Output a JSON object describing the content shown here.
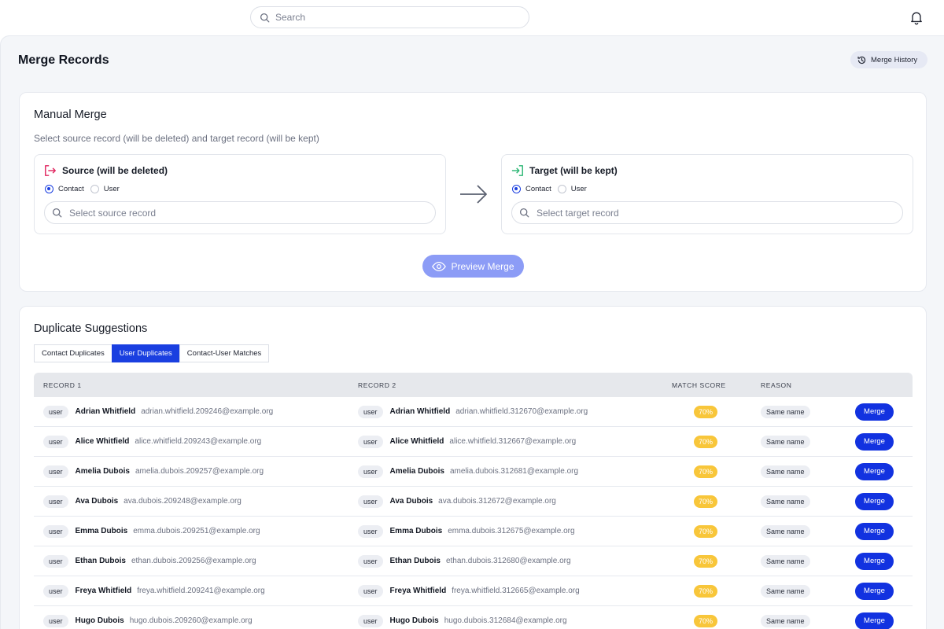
{
  "topbar": {
    "search_placeholder": "Search"
  },
  "page": {
    "title": "Merge Records",
    "history_label": "Merge History"
  },
  "manual": {
    "title": "Manual Merge",
    "subtitle": "Select source record (will be deleted) and target record (will be kept)",
    "source": {
      "title": "Source (will be deleted)",
      "options": [
        "Contact",
        "User"
      ],
      "selected": "Contact",
      "placeholder": "Select source record"
    },
    "target": {
      "title": "Target (will be kept)",
      "options": [
        "Contact",
        "User"
      ],
      "selected": "Contact",
      "placeholder": "Select target record"
    },
    "preview_label": "Preview Merge"
  },
  "duplicates": {
    "title": "Duplicate Suggestions",
    "tabs": [
      "Contact Duplicates",
      "User Duplicates",
      "Contact-User Matches"
    ],
    "active_tab": "User Duplicates",
    "columns": [
      "RECORD 1",
      "RECORD 2",
      "MATCH SCORE",
      "REASON"
    ],
    "merge_label": "Merge",
    "rows": [
      {
        "r1": {
          "type": "user",
          "name": "Adrian Whitfield",
          "email": "adrian.whitfield.209246@example.org"
        },
        "r2": {
          "type": "user",
          "name": "Adrian Whitfield",
          "email": "adrian.whitfield.312670@example.org"
        },
        "score": "70%",
        "reason": "Same name"
      },
      {
        "r1": {
          "type": "user",
          "name": "Alice Whitfield",
          "email": "alice.whitfield.209243@example.org"
        },
        "r2": {
          "type": "user",
          "name": "Alice Whitfield",
          "email": "alice.whitfield.312667@example.org"
        },
        "score": "70%",
        "reason": "Same name"
      },
      {
        "r1": {
          "type": "user",
          "name": "Amelia Dubois",
          "email": "amelia.dubois.209257@example.org"
        },
        "r2": {
          "type": "user",
          "name": "Amelia Dubois",
          "email": "amelia.dubois.312681@example.org"
        },
        "score": "70%",
        "reason": "Same name"
      },
      {
        "r1": {
          "type": "user",
          "name": "Ava Dubois",
          "email": "ava.dubois.209248@example.org"
        },
        "r2": {
          "type": "user",
          "name": "Ava Dubois",
          "email": "ava.dubois.312672@example.org"
        },
        "score": "70%",
        "reason": "Same name"
      },
      {
        "r1": {
          "type": "user",
          "name": "Emma Dubois",
          "email": "emma.dubois.209251@example.org"
        },
        "r2": {
          "type": "user",
          "name": "Emma Dubois",
          "email": "emma.dubois.312675@example.org"
        },
        "score": "70%",
        "reason": "Same name"
      },
      {
        "r1": {
          "type": "user",
          "name": "Ethan Dubois",
          "email": "ethan.dubois.209256@example.org"
        },
        "r2": {
          "type": "user",
          "name": "Ethan Dubois",
          "email": "ethan.dubois.312680@example.org"
        },
        "score": "70%",
        "reason": "Same name"
      },
      {
        "r1": {
          "type": "user",
          "name": "Freya Whitfield",
          "email": "freya.whitfield.209241@example.org"
        },
        "r2": {
          "type": "user",
          "name": "Freya Whitfield",
          "email": "freya.whitfield.312665@example.org"
        },
        "score": "70%",
        "reason": "Same name"
      },
      {
        "r1": {
          "type": "user",
          "name": "Hugo Dubois",
          "email": "hugo.dubois.209260@example.org"
        },
        "r2": {
          "type": "user",
          "name": "Hugo Dubois",
          "email": "hugo.dubois.312684@example.org"
        },
        "score": "70%",
        "reason": "Same name"
      }
    ]
  },
  "colors": {
    "accent": "#1a3fe0",
    "preview_button": "#8c9cf6",
    "score_badge": "#f8c63a",
    "source_icon": "#e0245e",
    "target_icon": "#2bb673"
  }
}
